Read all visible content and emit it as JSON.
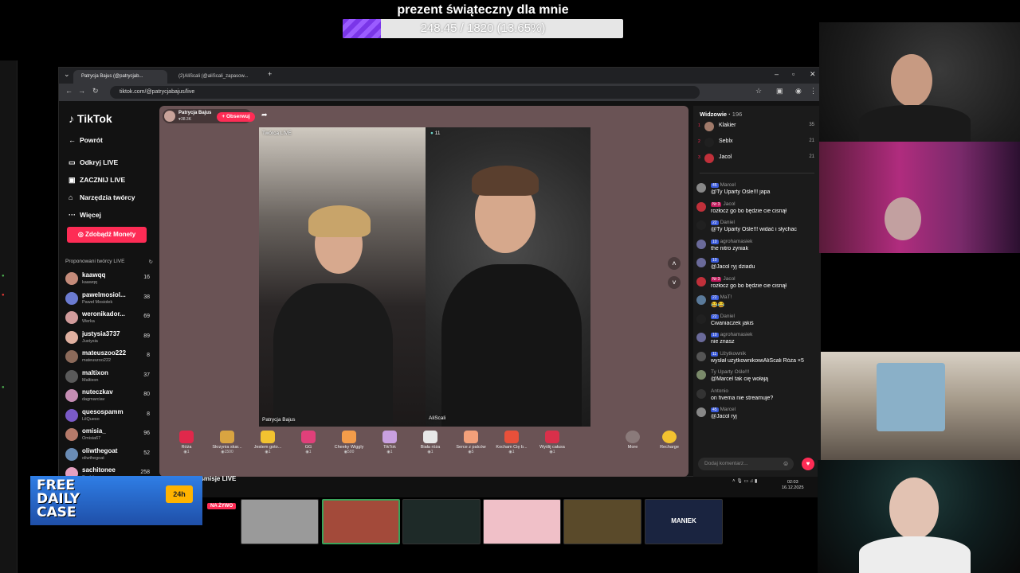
{
  "overlay": {
    "goal_title": "prezent świąteczny dla mnie",
    "goal_text": "248.45 / 1820 (13.65%)",
    "goal_progress": 0.1365,
    "goal_fill_color": "#7a36e8"
  },
  "browser": {
    "tabs": [
      {
        "label": "Patrycja Bajus (@patrycjab...",
        "active": true
      },
      {
        "label": "(2)AliScali (@aliScali_zapasow...",
        "active": false
      }
    ],
    "new_tab_icon": "plus-icon",
    "url": "tiktok.com/@patrycjabajus/live"
  },
  "tiktok": {
    "logo": "TikTok",
    "nav": [
      {
        "label": "Powrót",
        "icon": "back-arrow-icon"
      },
      {
        "label": "Odkryj LIVE",
        "icon": "live-icon"
      },
      {
        "label": "ZACZNIJ LIVE",
        "icon": "camera-icon"
      },
      {
        "label": "Narzędzia twórcy",
        "icon": "tools-icon"
      },
      {
        "label": "Więcej",
        "icon": "more-icon"
      }
    ],
    "coins_button": "Zdobądź Monety",
    "suggested_header": "Proponowani twórcy LIVE",
    "suggested": [
      {
        "name": "kaawqq",
        "sub": "kaawqq",
        "count": "16",
        "color": "#c48b7a"
      },
      {
        "name": "pawelmosiol...",
        "sub": "Paweł Mosiołek",
        "count": "38",
        "color": "#6b7bd1"
      },
      {
        "name": "weronikador...",
        "sub": "Werka",
        "count": "69",
        "color": "#d19b9b"
      },
      {
        "name": "justysia3737",
        "sub": "Justysia",
        "count": "89",
        "color": "#e0b0a0"
      },
      {
        "name": "mateuszoo222",
        "sub": "mateuszoo222",
        "count": "8",
        "color": "#8c6a5a"
      },
      {
        "name": "maltixon",
        "sub": "Maltixon",
        "count": "37",
        "color": "#5a5a5a"
      },
      {
        "name": "nuteczkav",
        "sub": "dagmarciav",
        "count": "80",
        "color": "#c58db3"
      },
      {
        "name": "quesospamm",
        "sub": "LilQueso",
        "count": "8",
        "color": "#7a5ac8"
      },
      {
        "name": "omisia_",
        "sub": "Omisia67",
        "count": "96",
        "color": "#b57a6a"
      },
      {
        "name": "oliwthegoat",
        "sub": "oliwthegoat",
        "count": "52",
        "color": "#6a8cb5"
      },
      {
        "name": "sachitonee",
        "sub": "Sachitone",
        "count": "258",
        "color": "#e5a0c0"
      }
    ]
  },
  "live": {
    "host_name": "Patrycja Bajus",
    "host_likes": "38.3K",
    "follow_button": "+ Obserwuj",
    "left_video_label": "Twórca LIVE",
    "left_video_name": "Patrycja Bajus",
    "right_video_badge": "11",
    "right_video_name": "AliScali",
    "gifts": [
      {
        "name": "Róża",
        "price": "1",
        "color": "#e0284b"
      },
      {
        "name": "Skrzynia skar...",
        "price": "1500",
        "color": "#d9a441"
      },
      {
        "name": "Jestem goto...",
        "price": "1",
        "color": "#f2c230"
      },
      {
        "name": "GG",
        "price": "1",
        "color": "#e0407a"
      },
      {
        "name": "Cheeky Wiggly",
        "price": "500",
        "color": "#f39c4a"
      },
      {
        "name": "TikTok",
        "price": "1",
        "color": "#c9a0e0"
      },
      {
        "name": "Biała róża",
        "price": "1",
        "color": "#e8e8e8"
      },
      {
        "name": "Serce z palców",
        "price": "5",
        "color": "#f2a07a"
      },
      {
        "name": "Kocham Cię b...",
        "price": "1",
        "color": "#e8503a"
      },
      {
        "name": "Wyślij całusa",
        "price": "1",
        "color": "#d9304a"
      }
    ],
    "more_label": "More",
    "recharge_label": "Recharge"
  },
  "chat": {
    "viewers_label": "Widzowie",
    "viewers_count": "196",
    "top_viewers": [
      {
        "rank": "1",
        "name": "Klakier",
        "score": "35",
        "color": "#a07a6a"
      },
      {
        "rank": "2",
        "name": "Seblx",
        "score": "21",
        "color": "#202020"
      },
      {
        "rank": "3",
        "name": "Jacol",
        "score": "21",
        "color": "#c0303a"
      }
    ],
    "messages": [
      {
        "user": "Marcel",
        "badge": "45",
        "badge_color": "blue",
        "text": "@Ty Uparty Ośle!!! japa",
        "color": "#888"
      },
      {
        "user": "Jacol",
        "badge": "Nr 3",
        "badge_color": "red",
        "text": "rozłocz go bo będzie cie cisnął",
        "color": "#c0303a"
      },
      {
        "user": "Daniel",
        "badge": "22",
        "badge_color": "blue",
        "text": "@Ty Uparty Ośle!!! widać i słychac",
        "color": "#202020"
      },
      {
        "user": "agrohamasiek",
        "badge": "10",
        "badge_color": "blue",
        "text": "the nitro zyniak",
        "color": "#6a6a9a"
      },
      {
        "user": "",
        "badge": "10",
        "badge_color": "blue",
        "text": "@Jacol ryj dziadu",
        "color": "#6a6a9a"
      },
      {
        "user": "Jacol",
        "badge": "Nr 3",
        "badge_color": "red",
        "text": "rozłocz go bo będzie cie cisnął",
        "color": "#c0303a"
      },
      {
        "user": "MaT!",
        "badge": "22",
        "badge_color": "blue",
        "text": "😂😂",
        "color": "#5a7a9a"
      },
      {
        "user": "Daniel",
        "badge": "22",
        "badge_color": "blue",
        "text": "Cwaniaczek jakiś",
        "color": "#202020"
      },
      {
        "user": "agrohamasiek",
        "badge": "10",
        "badge_color": "blue",
        "text": "nie znasz",
        "color": "#6a6a9a"
      },
      {
        "user": "Użytkownik",
        "badge": "11",
        "badge_color": "blue",
        "text": "wysłał użytkownikowiAliScali Róża ×5",
        "color": "#555"
      },
      {
        "user": "Ty Uparty Ośle!!!",
        "badge": "",
        "badge_color": "blue",
        "text": "@Marcel tak cię wołają",
        "color": "#7a8a6a"
      },
      {
        "user": "Antonio",
        "badge": "",
        "badge_color": "blue",
        "text": "on fivema nie streamuje?",
        "color": "#333"
      },
      {
        "user": "Marcel",
        "badge": "45",
        "badge_color": "blue",
        "text": "@Jacol ryj",
        "color": "#888"
      }
    ],
    "comment_placeholder": "Dodaj komentarz..."
  },
  "taskbar": {
    "recommended_label": "Polecane transmisje LIVE",
    "time": "02:03",
    "date": "16.12.2025"
  },
  "promo": {
    "text_line1": "FREE",
    "text_line2": "DAILY",
    "text_line3": "CASE",
    "badge": "24h"
  },
  "bottom_row": {
    "live_badge": "NA ŻYWO",
    "thumbs": [
      {
        "label": "",
        "color": "#9a9a9a"
      },
      {
        "label": "",
        "color": "#a34a3a"
      },
      {
        "label": "",
        "color": "#1e2a28"
      },
      {
        "label": "",
        "color": "#f0c0c8"
      },
      {
        "label": "",
        "color": "#5a4a2a"
      },
      {
        "label": "MANIEK",
        "color": "#1a2440"
      }
    ]
  }
}
